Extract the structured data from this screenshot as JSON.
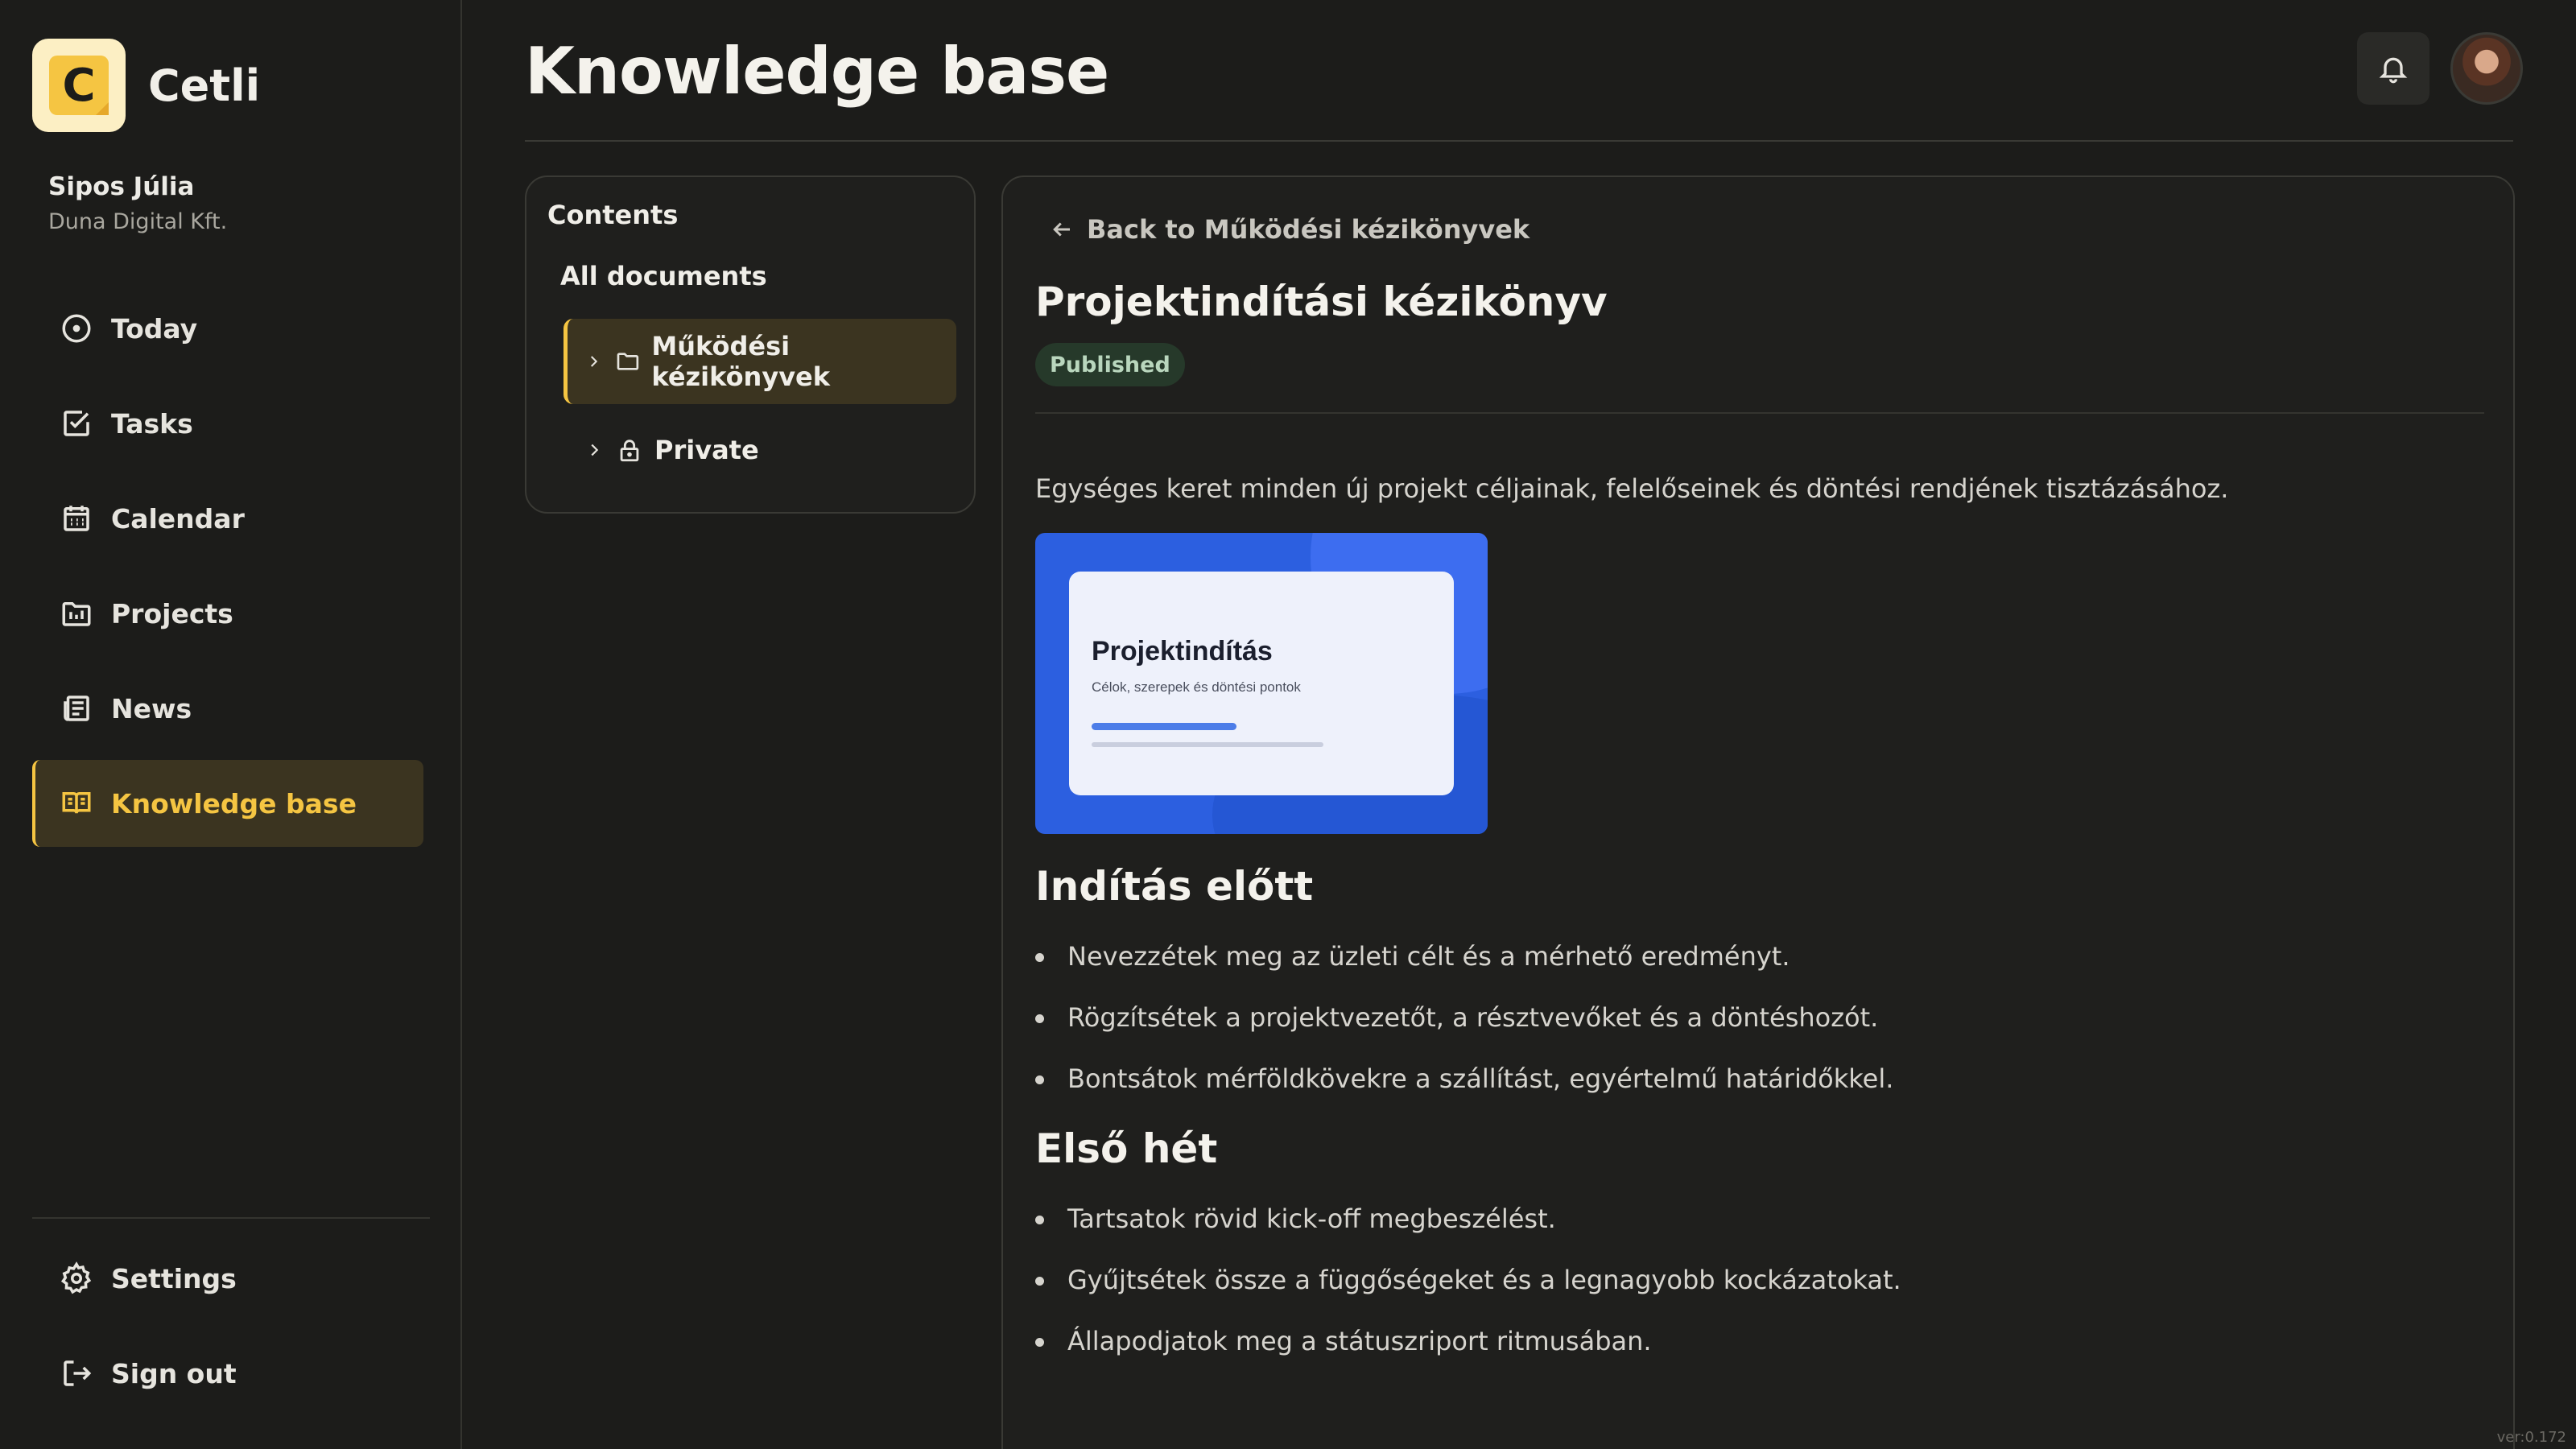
{
  "app": {
    "name": "Cetli",
    "logo_letter": "C"
  },
  "user": {
    "name": "Sipos Júlia",
    "org": "Duna Digital Kft."
  },
  "nav": [
    {
      "label": "Today",
      "icon": "clock-icon"
    },
    {
      "label": "Tasks",
      "icon": "checkbox-icon"
    },
    {
      "label": "Calendar",
      "icon": "calendar-icon"
    },
    {
      "label": "Projects",
      "icon": "folder-chart-icon"
    },
    {
      "label": "News",
      "icon": "newspaper-icon"
    },
    {
      "label": "Knowledge base",
      "icon": "book-icon",
      "active": true
    }
  ],
  "bottom_nav": [
    {
      "label": "Settings",
      "icon": "gear-icon"
    },
    {
      "label": "Sign out",
      "icon": "sign-out-icon"
    }
  ],
  "header": {
    "title": "Knowledge base"
  },
  "contents": {
    "title": "Contents",
    "all_docs": "All documents",
    "items": [
      {
        "label": "Működési kézikönyvek",
        "icon": "folder-icon",
        "active": true
      },
      {
        "label": "Private",
        "icon": "lock-icon"
      }
    ]
  },
  "document": {
    "back_label": "Back to Működési kézikönyvek",
    "title": "Projektindítási kézikönyv",
    "status": "Published",
    "description": "Egységes keret minden új projekt céljainak, felelőseinek és döntési rendjének tisztázásához.",
    "preview": {
      "title": "Projektindítás",
      "subtitle": "Célok, szerepek és döntési pontok"
    },
    "sections": [
      {
        "heading": "Indítás előtt",
        "items": [
          "Nevezzétek meg az üzleti célt és a mérhető eredményt.",
          "Rögzítsétek a projektvezetőt, a résztvevőket és a döntéshozót.",
          "Bontsátok mérföldkövekre a szállítást, egyértelmű határidőkkel."
        ]
      },
      {
        "heading": "Első hét",
        "items": [
          "Tartsatok rövid kick-off megbeszélést.",
          "Gyűjtsétek össze a függőségeket és a legnagyobb kockázatokat.",
          "Állapodjatok meg a státuszriport ritmusában."
        ]
      }
    ]
  },
  "version": "ver:0.172",
  "colors": {
    "accent": "#f5c542",
    "background": "#1c1c1a",
    "active_bg": "#3b3420",
    "badge_bg": "#26392a"
  }
}
